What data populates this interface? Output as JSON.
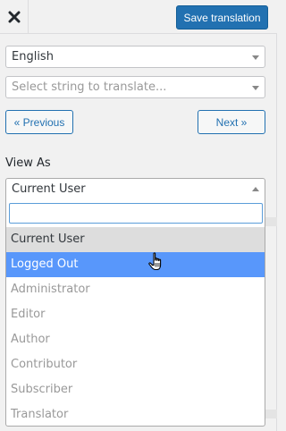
{
  "toolbar": {
    "close_icon": "close-icon",
    "save_label": "Save translation"
  },
  "language_select": {
    "value": "English"
  },
  "string_select": {
    "placeholder": "Select string to translate..."
  },
  "nav": {
    "previous_label": "« Previous",
    "next_label": "Next »"
  },
  "view_as": {
    "label": "View As",
    "value": "Current User",
    "search_value": "",
    "options": [
      {
        "label": "Current User",
        "state": "selected"
      },
      {
        "label": "Logged Out",
        "state": "highlighted"
      },
      {
        "label": "Administrator",
        "state": "disabled"
      },
      {
        "label": "Editor",
        "state": "disabled"
      },
      {
        "label": "Author",
        "state": "disabled"
      },
      {
        "label": "Contributor",
        "state": "disabled"
      },
      {
        "label": "Subscriber",
        "state": "disabled"
      },
      {
        "label": "Translator",
        "state": "disabled"
      }
    ]
  },
  "colors": {
    "accent": "#2271b1",
    "highlight": "#5897fb",
    "selected_bg": "#dddddd",
    "disabled_text": "#999999"
  }
}
